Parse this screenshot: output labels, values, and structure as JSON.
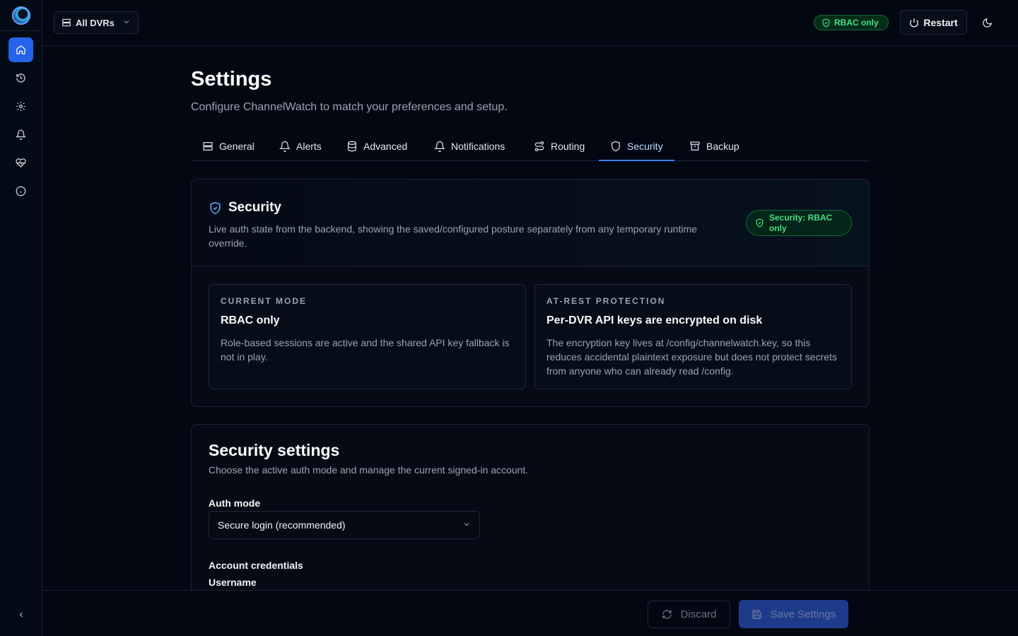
{
  "sidebar": {
    "items": [
      {
        "icon": "home-icon",
        "active": true
      },
      {
        "icon": "history-icon",
        "active": false
      },
      {
        "icon": "gear-icon",
        "active": false
      },
      {
        "icon": "bell-icon",
        "active": false
      },
      {
        "icon": "heart-pulse-icon",
        "active": false
      },
      {
        "icon": "info-icon",
        "active": false
      }
    ]
  },
  "topbar": {
    "dvr_selector": "All DVRs",
    "auth_badge": "RBAC only",
    "restart_label": "Restart"
  },
  "page": {
    "title": "Settings",
    "subtitle": "Configure ChannelWatch to match your preferences and setup."
  },
  "tabs": [
    {
      "label": "General",
      "icon": "server-icon"
    },
    {
      "label": "Alerts",
      "icon": "bell-icon"
    },
    {
      "label": "Advanced",
      "icon": "database-icon"
    },
    {
      "label": "Notifications",
      "icon": "bell-icon"
    },
    {
      "label": "Routing",
      "icon": "route-icon"
    },
    {
      "label": "Security",
      "icon": "shield-icon",
      "active": true
    },
    {
      "label": "Backup",
      "icon": "archive-icon"
    }
  ],
  "security": {
    "title": "Security",
    "description": "Live auth state from the backend, showing the saved/configured posture separately from any temporary runtime override.",
    "badge_line1": "Security: RBAC",
    "badge_line2": "only",
    "current_mode": {
      "label": "CURRENT MODE",
      "title": "RBAC only",
      "body": "Role-based sessions are active and the shared API key fallback is not in play."
    },
    "at_rest": {
      "label": "AT-REST PROTECTION",
      "title": "Per-DVR API keys are encrypted on disk",
      "body": "The encryption key lives at /config/channelwatch.key, so this reduces accidental plaintext exposure but does not protect secrets from anyone who can already read /config."
    }
  },
  "security_settings": {
    "title": "Security settings",
    "description": "Choose the active auth mode and manage the current signed-in account.",
    "auth_mode_label": "Auth mode",
    "auth_mode_value": "Secure login (recommended)",
    "account_credentials_label": "Account credentials",
    "username_label": "Username"
  },
  "actions": {
    "discard_label": "Discard",
    "save_label": "Save Settings"
  },
  "colors": {
    "accent": "#2563eb",
    "success": "#4ade80",
    "background": "#030712"
  }
}
